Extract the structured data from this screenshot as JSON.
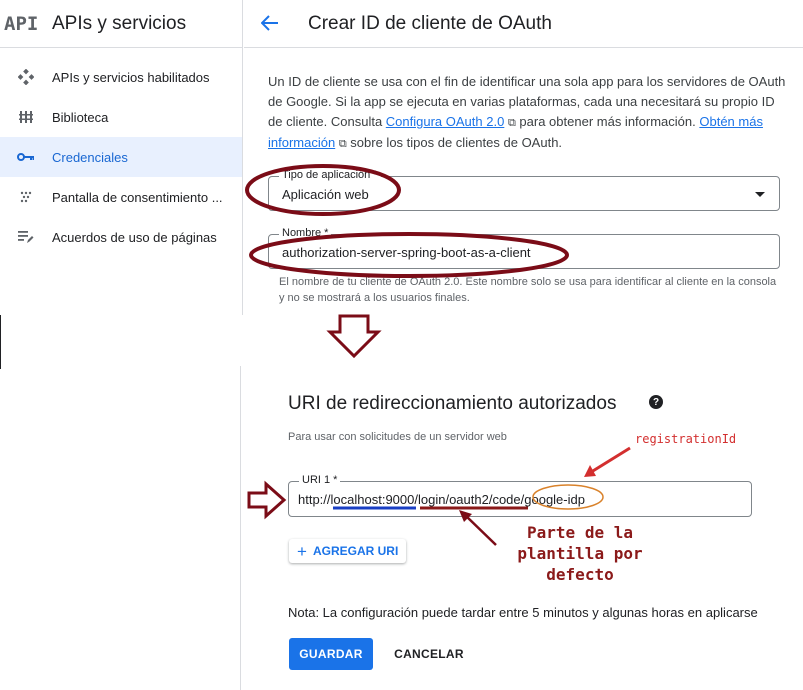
{
  "sidebar": {
    "logo": "API",
    "title": "APIs y servicios",
    "items": [
      {
        "label": "APIs y servicios habilitados",
        "icon": "enabled-apis-icon"
      },
      {
        "label": "Biblioteca",
        "icon": "library-icon"
      },
      {
        "label": "Credenciales",
        "icon": "key-icon",
        "active": true
      },
      {
        "label": "Pantalla de consentimiento ...",
        "icon": "consent-screen-icon"
      },
      {
        "label": "Acuerdos de uso de páginas",
        "icon": "agreements-icon"
      }
    ]
  },
  "header": {
    "title": "Crear ID de cliente de OAuth"
  },
  "intro": {
    "text1": "Un ID de cliente se usa con el fin de identificar una sola app para los servidores de OAuth de Google. Si la app se ejecuta en varias plataformas, cada una necesitará su propio ID de cliente. Consulta ",
    "link1": "Configura OAuth 2.0",
    "text2": " para obtener más información. ",
    "link2": "Obtén más información",
    "text3": " sobre los tipos de clientes de OAuth."
  },
  "app_type": {
    "label": "Tipo de aplicación *",
    "value": "Aplicación web"
  },
  "name_field": {
    "label": "Nombre *",
    "value": "authorization-server-spring-boot-as-a-client",
    "hint": "El nombre de tu cliente de OAuth 2.0. Este nombre solo se usa para identificar al cliente en la consola y no se mostrará a los usuarios finales."
  },
  "redirect": {
    "title": "URI de redireccionamiento autorizados",
    "subtitle": "Para usar con solicitudes de un servidor web",
    "uri_label": "URI 1 *",
    "uri_part1": "http://",
    "uri_part2": "localhost:9000",
    "uri_part3": "/login/oauth2/code/",
    "uri_part4": "google-idp",
    "add_button": "AGREGAR URI"
  },
  "note": "Nota: La configuración puede tardar entre 5 minutos y algunas horas en aplicarse",
  "buttons": {
    "save": "GUARDAR",
    "cancel": "CANCELAR"
  },
  "annotations": {
    "registration_id": "registrationId",
    "parte_line1": "Parte de la",
    "parte_line2": "plantilla por",
    "parte_line3": "defecto"
  },
  "colors": {
    "accent": "#1a73e8",
    "annotation_dark": "#7b0c17",
    "annotation_red": "#d32f2f",
    "underline_blue": "#1a3fc4",
    "underline_red": "#8b1a1a",
    "circle_orange": "#d9822b"
  }
}
